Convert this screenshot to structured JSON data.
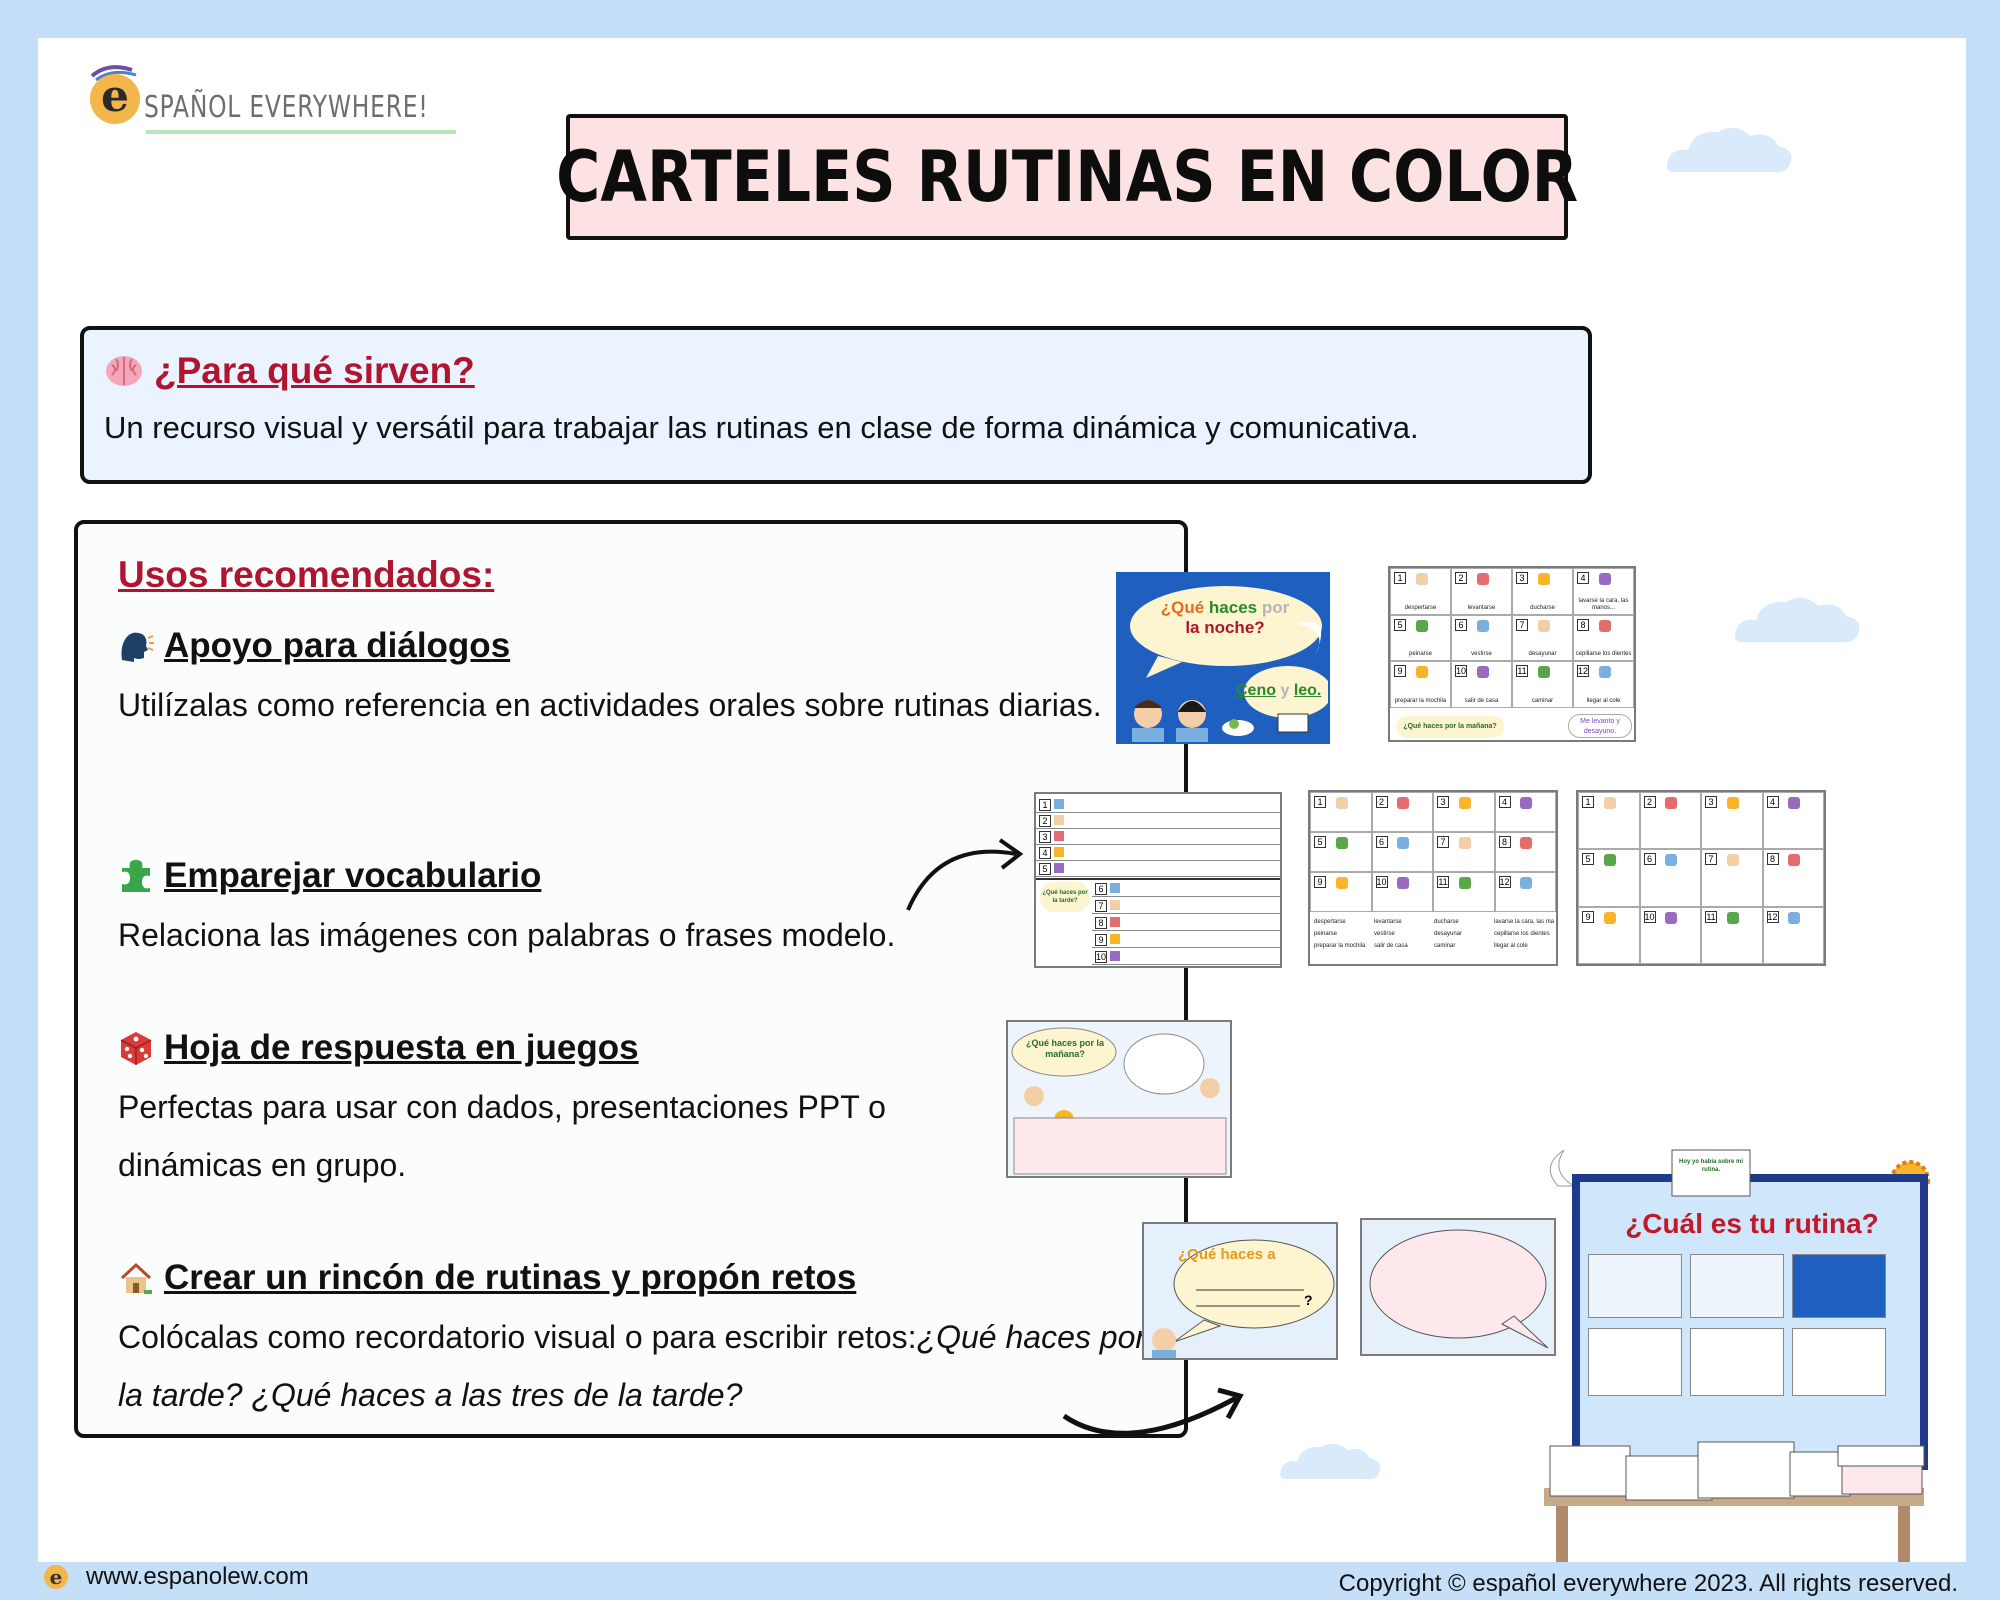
{
  "logo": {
    "text": "SPAÑOL EVERYWHERE!",
    "letter": "e"
  },
  "title": "CARTELES RUTINAS EN COLOR",
  "purpose": {
    "heading": "¿Para qué sirven?",
    "text": "Un recurso visual y versátil para trabajar las rutinas en clase de forma dinámica y comunicativa."
  },
  "uses": {
    "heading": "Usos recomendados:",
    "sections": [
      {
        "icon": "speaking-head-icon",
        "title": "Apoyo para diálogos",
        "body": "Utilízalas como referencia en actividades orales sobre rutinas diarias."
      },
      {
        "icon": "puzzle-piece-icon",
        "title": "Emparejar vocabulario",
        "body": "Relaciona las imágenes con palabras o frases modelo."
      },
      {
        "icon": "dice-icon",
        "title": "Hoja de respuesta en juegos",
        "body": "Perfectas para usar con dados, presentaciones PPT o dinámicas en grupo."
      },
      {
        "icon": "house-icon",
        "title": "Crear un rincón de rutinas y propón retos",
        "body": "Colócalas como recordatorio visual o para escribir retos:",
        "body_italic": "¿Qué haces por la tarde? ¿Qué haces a las tres de la tarde?"
      }
    ]
  },
  "thumbnails": {
    "night_poster": {
      "question_a": "¿Qué",
      "question_b": "haces",
      "question_c": "por",
      "question_d": "la noche?",
      "answer_a": "Ceno",
      "answer_b": "y",
      "answer_c": "leo."
    },
    "routine_labels": [
      "despertarse",
      "levantarse",
      "ducharse",
      "lavarse la cara, las manos...",
      "peinarse",
      "vestirse",
      "desayunar",
      "cepillarse los dientes",
      "preparar la mochila",
      "salir de casa",
      "caminar",
      "llegar al cole"
    ],
    "routine_bubble_left": "¿Qué haces por la mañana?",
    "routine_bubble_right": "Me levanto y desayuno.",
    "tarde_question": "¿Qué haces por la tarde?",
    "morning_question": "¿Qué haces por la mañana?",
    "a_question": "¿Qué haces a",
    "question_mark": "?",
    "board_title": "¿Cuál es tu rutina?",
    "board_banner": "Hoy yo había sobre mi rutina."
  },
  "footer": {
    "url": "www.espanolew.com",
    "copyright": "Copyright © español everywhere 2023. All rights reserved."
  },
  "colors": {
    "background": "#c6dff8",
    "title_fill": "#fde2e4",
    "purpose_fill": "#eaf3ff",
    "heading_red": "#b0152f",
    "poster_blue": "#1f5fbf"
  }
}
